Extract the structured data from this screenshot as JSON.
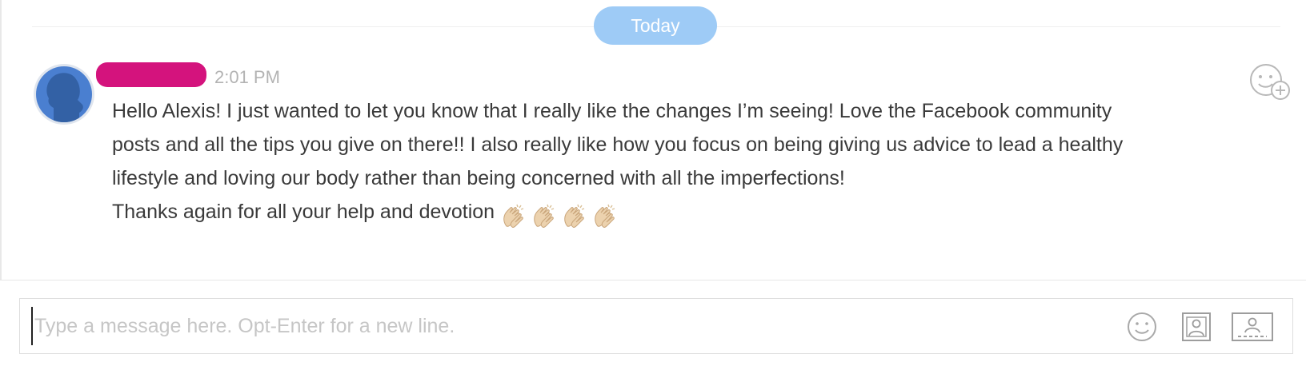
{
  "divider": {
    "label": "Today"
  },
  "message": {
    "timestamp": "2:01 PM",
    "paragraphs": [
      "Hello Alexis! I just wanted to let you know that I really like the changes I’m seeing! Love the Facebook community",
      "posts and all the tips you give on there!! I also really like how you focus on being giving us advice to lead a healthy",
      "lifestyle and loving our body rather than being concerned with all the imperfections!",
      "Thanks again for all your help and devotion"
    ],
    "trailing_emoji": [
      "clapping-hands",
      "clapping-hands",
      "clapping-hands",
      "clapping-hands"
    ]
  },
  "composer": {
    "placeholder": "Type a message here. Opt-Enter for a new line."
  },
  "icons": {
    "reaction": "add-reaction-icon",
    "emoji": "smiley-icon",
    "photo": "photo-upload-icon",
    "screen": "screen-share-icon"
  },
  "colors": {
    "day_pill": "#9ecbf6",
    "redacted_name": "#d4137d",
    "avatar": "#4a7fd0",
    "text": "#3a3a3a",
    "muted": "#b3b3b3"
  }
}
